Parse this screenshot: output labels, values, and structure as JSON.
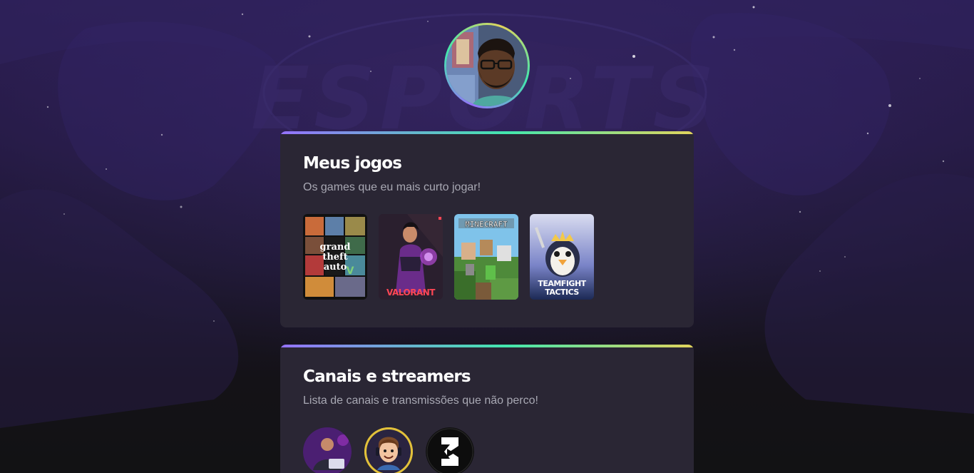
{
  "profile": {
    "avatar_icon": "user-avatar-photo"
  },
  "games_section": {
    "title": "Meus jogos",
    "subtitle": "Os games que eu mais curto jogar!",
    "games": [
      {
        "name": "gta-v",
        "cover_text": [
          "grand",
          "theft",
          "auto"
        ],
        "icon": "gta-v-cover"
      },
      {
        "name": "valorant",
        "cover_text": "VALORANT",
        "icon": "valorant-cover"
      },
      {
        "name": "minecraft",
        "cover_text": "MINECRAFT",
        "icon": "minecraft-cover"
      },
      {
        "name": "teamfight-tactics",
        "cover_text": [
          "TEAMFIGHT",
          "TACTICS"
        ],
        "icon": "teamfight-tactics-cover"
      }
    ]
  },
  "channels_section": {
    "title": "Canais e streamers",
    "subtitle": "Lista de canais e transmissões que não perco!",
    "channels": [
      {
        "name": "channel-1",
        "icon": "streamer-avatar-1"
      },
      {
        "name": "channel-2",
        "icon": "streamer-avatar-2"
      },
      {
        "name": "channel-3",
        "icon": "channel-logo-3"
      }
    ]
  },
  "colors": {
    "gradient_start": "#9572fc",
    "gradient_mid": "#43e7ad",
    "gradient_end": "#e2d45c",
    "card_bg": "#2a2634",
    "subtitle": "#a8a8b3"
  }
}
